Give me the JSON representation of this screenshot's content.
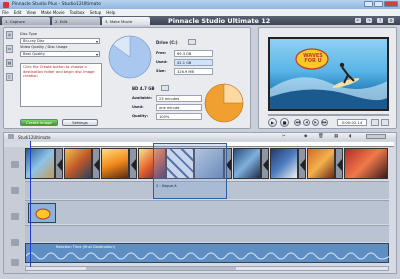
{
  "window": {
    "title": "Pinnacle Studio Plus - Studio12Ultimate"
  },
  "menu": [
    "File",
    "Edit",
    "View",
    "Make Movie",
    "Toolbox",
    "Setup",
    "Help"
  ],
  "mode_tabs": [
    "1. Capture",
    "2. Edit",
    "3. Make Movie"
  ],
  "app_title": "Pinnacle Studio Ultimate 12",
  "disc": {
    "disc_type_label": "Disc Type",
    "disc_type_value": "Blu-ray Disc",
    "quality_label": "Video Quality / Disc Usage",
    "quality_value": "Best Quality",
    "info_text": "Click the Create button to choose a destination folder and begin disc image creation",
    "create_button": "Create image",
    "settings_button": "Settings"
  },
  "drive": {
    "title": "Drive (C:)",
    "rows": [
      {
        "label": "Free:",
        "value": "69.3 GB"
      },
      {
        "label": "Used:",
        "value": "42.1 GB"
      },
      {
        "label": "Size:",
        "value": "326.9 MB"
      }
    ]
  },
  "bd": {
    "title": "BD",
    "size": "4.7 GB",
    "rows": [
      {
        "label": "Available:",
        "value": "23 minutes"
      },
      {
        "label": "Used:",
        "value": "one minute"
      },
      {
        "label": "Quality:",
        "value": "100%"
      }
    ]
  },
  "player": {
    "timecode": "0:00:02.14",
    "logo_text": "WAVES FOR U"
  },
  "timeline": {
    "project": "Studi12Ultimate",
    "clip_caption": "2 : Segue A",
    "audio_caption": "Reaction Time (final Destination)"
  },
  "colors": {
    "accent": "#2d5fa8",
    "create": "#3c9a2c",
    "pie": "#f0a030"
  }
}
